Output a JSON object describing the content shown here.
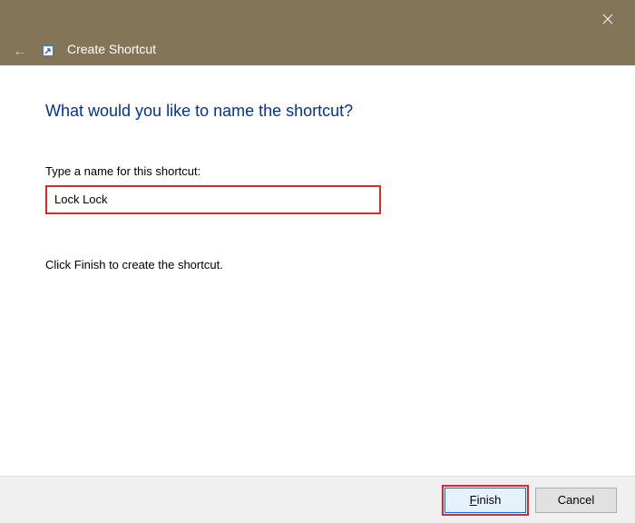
{
  "titlebar": {
    "title": "Create Shortcut"
  },
  "content": {
    "heading": "What would you like to name the shortcut?",
    "input_label": "Type a name for this shortcut:",
    "input_value": "Lock Lock",
    "instruction": "Click Finish to create the shortcut."
  },
  "footer": {
    "finish_prefix": "F",
    "finish_rest": "inish",
    "cancel_label": "Cancel"
  }
}
